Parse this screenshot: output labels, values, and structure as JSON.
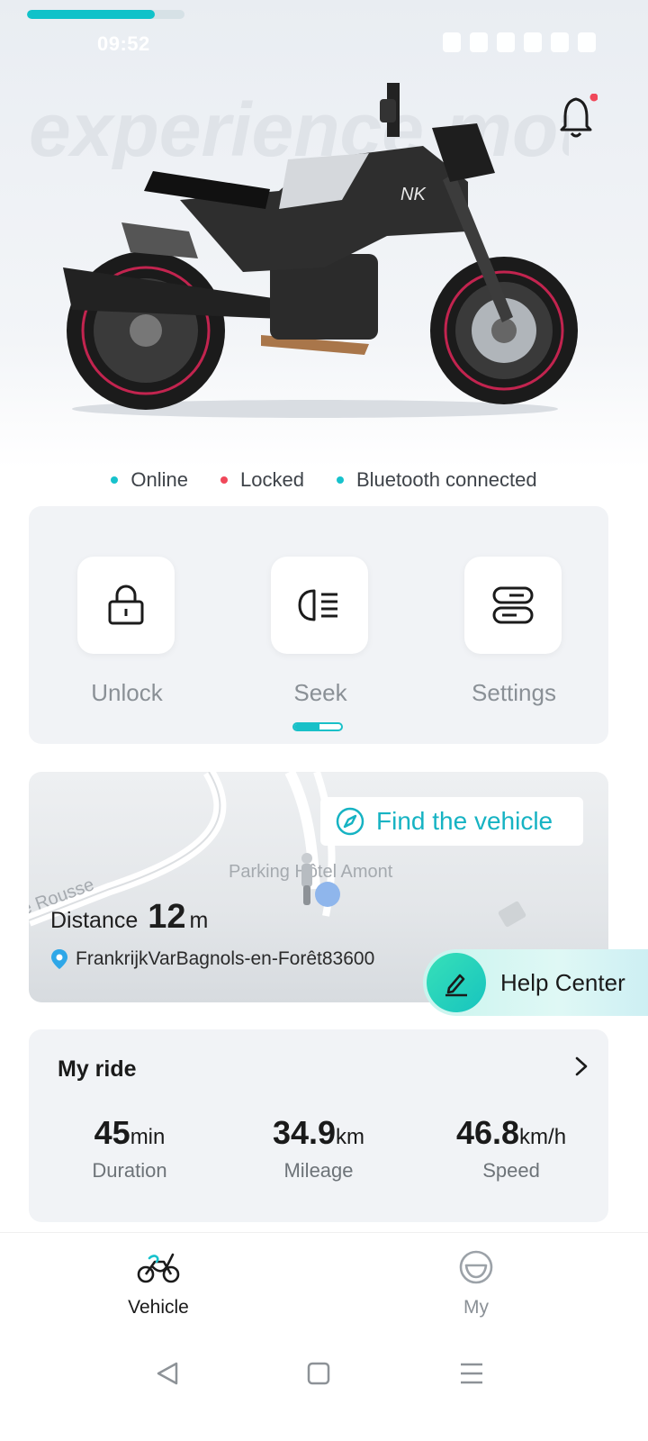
{
  "status_bar": {
    "time": "09:52",
    "progress": 0.81
  },
  "hero": {
    "background_text": "experience motor freedom",
    "model_badge": "NK"
  },
  "vehicle_status": [
    {
      "label": "Online",
      "color": "#17c2cc"
    },
    {
      "label": "Locked",
      "color": "#f0485a"
    },
    {
      "label": "Bluetooth connected",
      "color": "#17c2cc"
    }
  ],
  "controls": [
    {
      "label": "Unlock",
      "icon": "lock-icon"
    },
    {
      "label": "Seek",
      "icon": "headlight-icon"
    },
    {
      "label": "Settings",
      "icon": "toggles-icon"
    }
  ],
  "map": {
    "find_button": "Find the vehicle",
    "place_label": "Parking Hôtel Amont",
    "street_label": "e Rousse",
    "distance_label": "Distance",
    "distance_value": "12",
    "distance_unit": "m",
    "address": "FrankrijkVarBagnols-en-Forêt83600"
  },
  "help": {
    "label": "Help Center"
  },
  "ride": {
    "title": "My ride",
    "stats": [
      {
        "value": "45",
        "unit": "min",
        "caption": "Duration"
      },
      {
        "value": "34.9",
        "unit": "km",
        "caption": "Mileage"
      },
      {
        "value": "46.8",
        "unit": "km/h",
        "caption": "Speed"
      }
    ]
  },
  "nav": {
    "vehicle": "Vehicle",
    "my": "My"
  },
  "colors": {
    "accent": "#17c2cc",
    "alert": "#f0485a"
  }
}
